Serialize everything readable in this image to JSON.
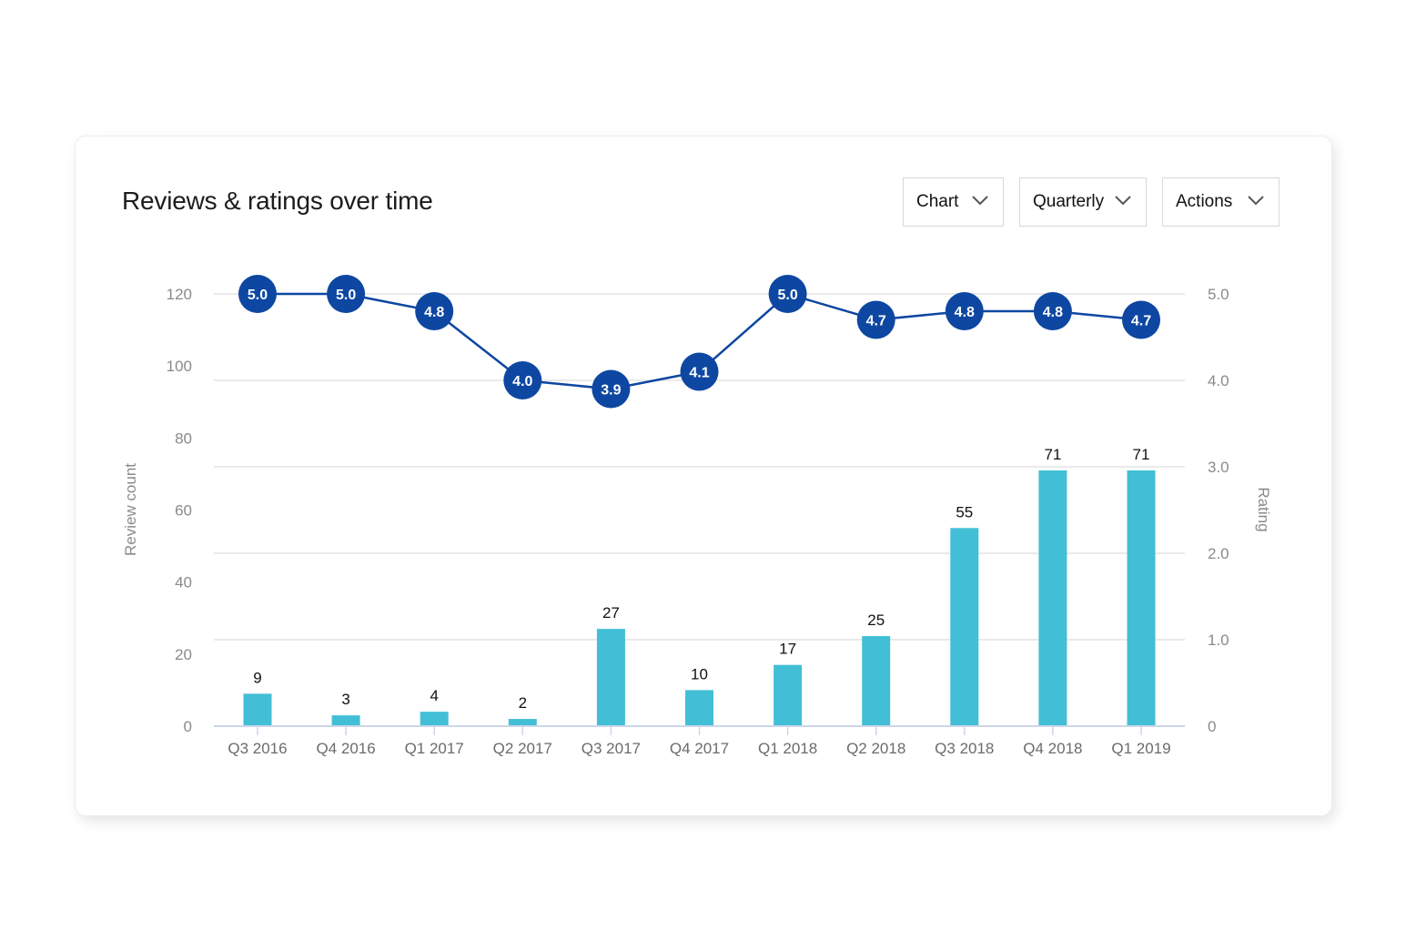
{
  "card": {
    "title": "Reviews & ratings over time",
    "controls": [
      {
        "label": "Chart",
        "icon": "chevron-down-icon"
      },
      {
        "label": "Quarterly",
        "icon": "chevron-down-icon"
      },
      {
        "label": "Actions",
        "icon": "chevron-down-icon"
      }
    ]
  },
  "colors": {
    "bar": "#42bfd6",
    "line": "#0e47a1",
    "grid": "#e4e4e4",
    "axis": "#cdd6ea"
  },
  "chart_data": {
    "type": "bar+line",
    "title": "Reviews & ratings over time",
    "categories": [
      "Q3 2016",
      "Q4 2016",
      "Q1 2017",
      "Q2 2017",
      "Q3 2017",
      "Q4 2017",
      "Q1 2018",
      "Q2 2018",
      "Q3 2018",
      "Q4 2018",
      "Q1 2019"
    ],
    "series": [
      {
        "name": "Review count",
        "type": "bar",
        "axis": "left",
        "values": [
          9,
          3,
          4,
          2,
          27,
          10,
          17,
          25,
          55,
          71,
          71
        ]
      },
      {
        "name": "Rating",
        "type": "line",
        "axis": "right",
        "values": [
          5.0,
          5.0,
          4.8,
          4.0,
          3.9,
          4.1,
          5.0,
          4.7,
          4.8,
          4.8,
          4.7
        ]
      }
    ],
    "y_left": {
      "label": "Review count",
      "ticks": [
        "0",
        "20",
        "40",
        "60",
        "80",
        "100",
        "120"
      ],
      "range": [
        0,
        120
      ]
    },
    "y_right": {
      "label": "Rating",
      "ticks": [
        "0",
        "1.0",
        "2.0",
        "3.0",
        "4.0",
        "5.0"
      ],
      "range": [
        0,
        5
      ]
    },
    "grid": true,
    "legend": "none"
  }
}
